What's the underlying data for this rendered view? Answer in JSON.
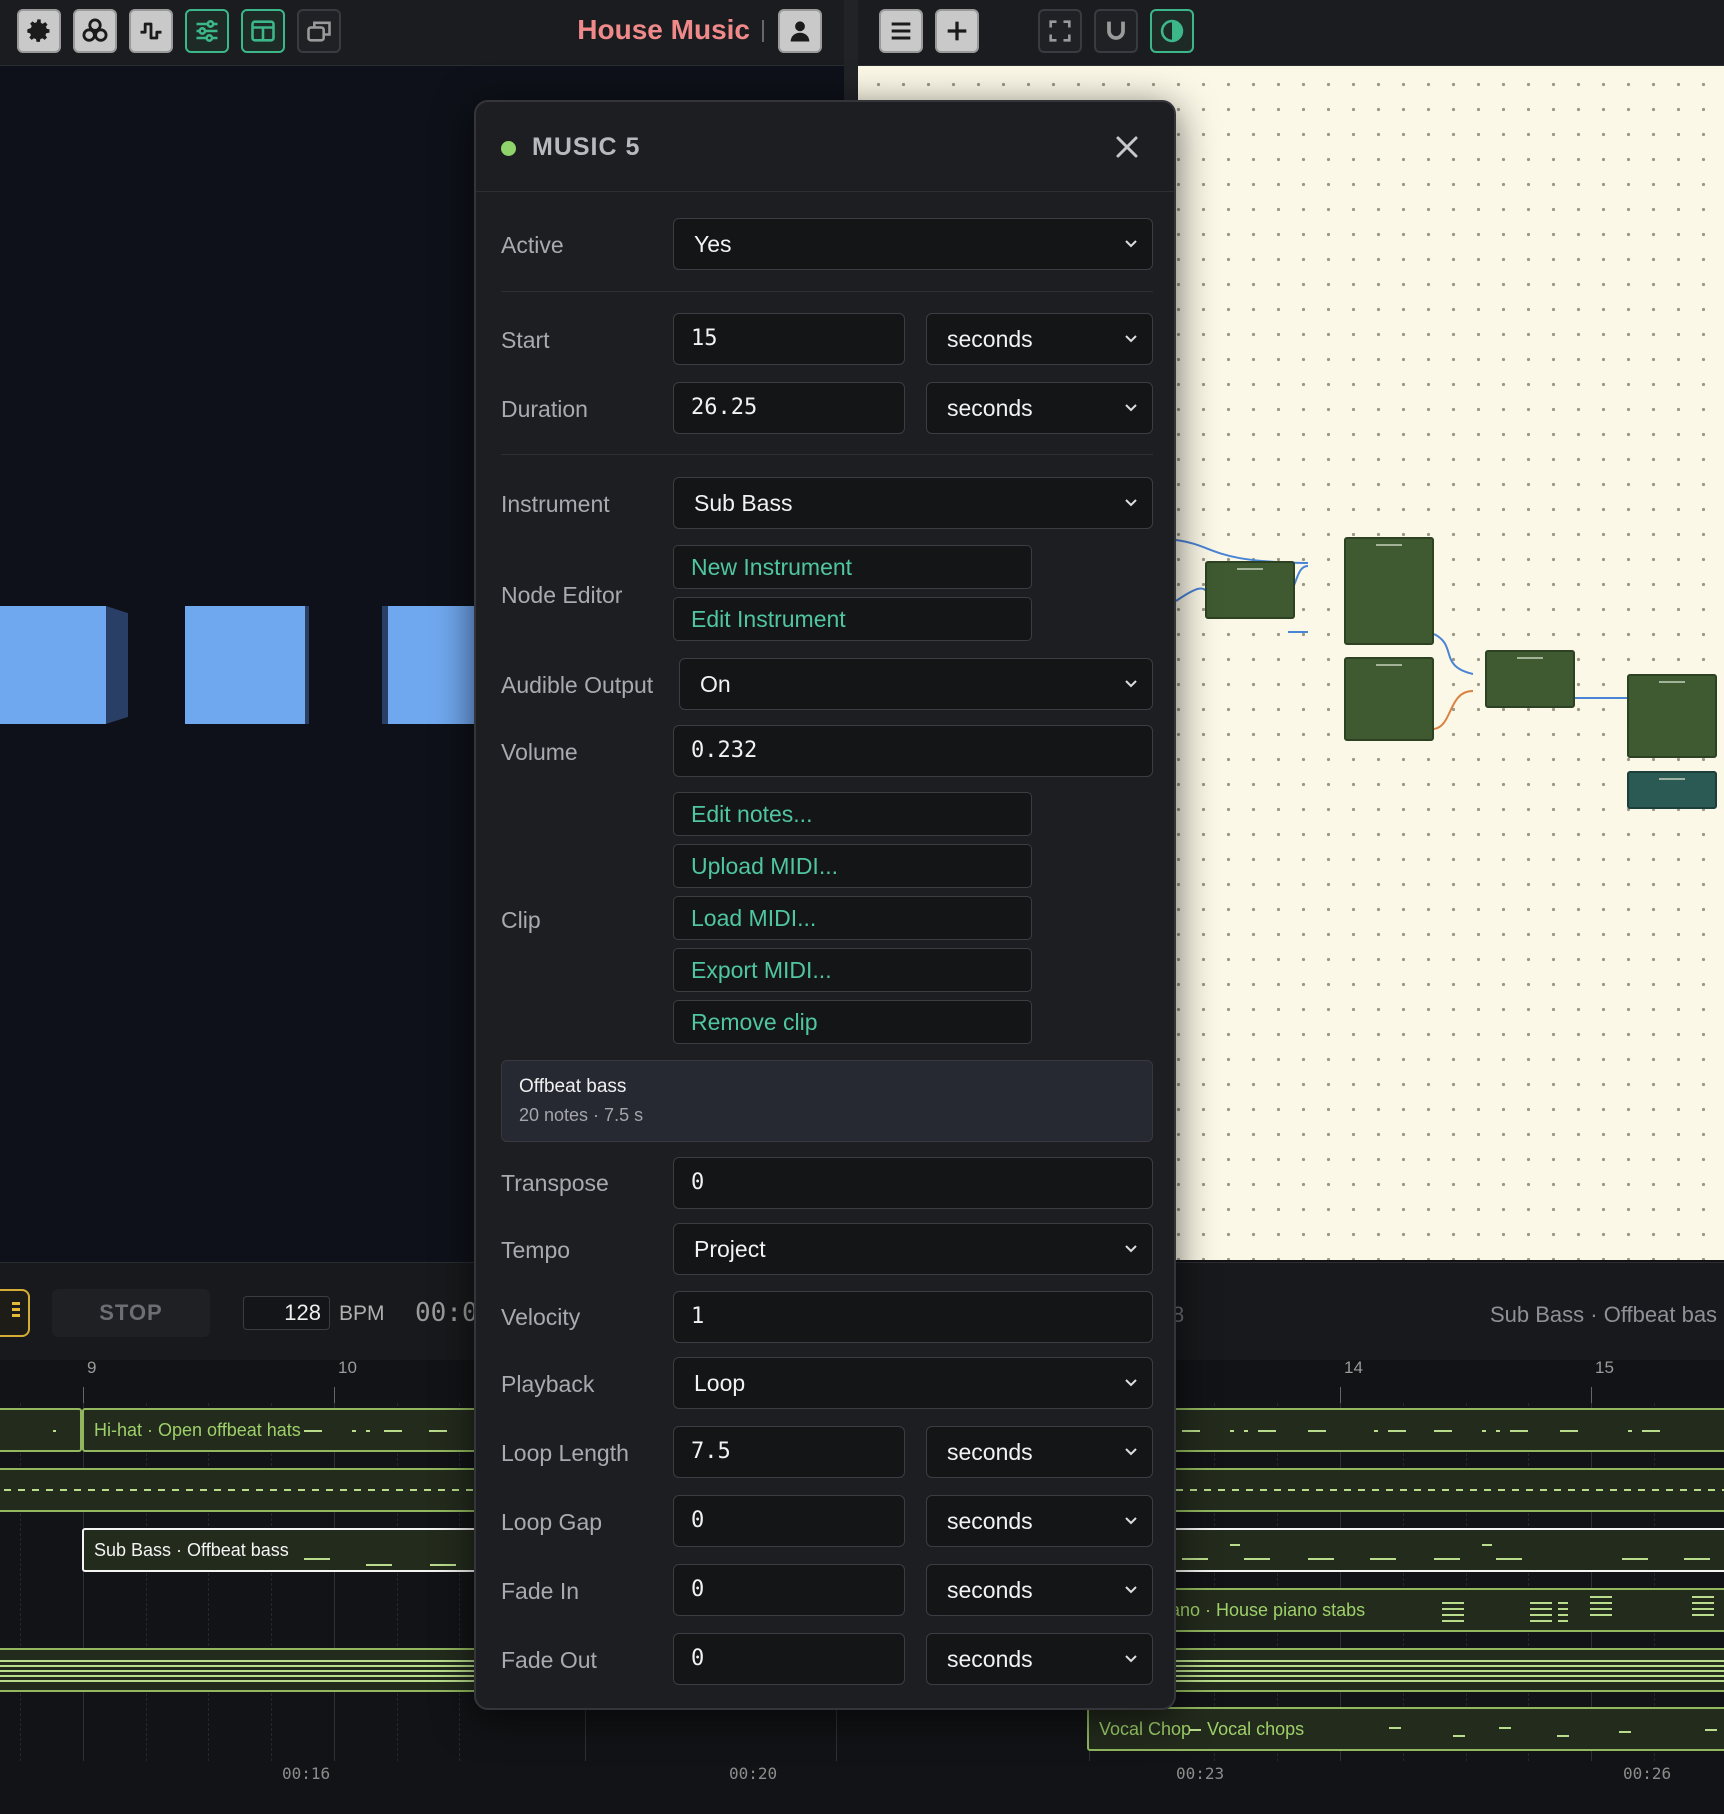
{
  "toolbar": {
    "project_title": "House Music"
  },
  "transport": {
    "stop_label": "STOP",
    "bpm_value": "128",
    "bpm_label": "BPM",
    "time_partial": "00:0",
    "marker_partial": "8",
    "selected_clip_info": "Sub Bass · Offbeat bas"
  },
  "timeline": {
    "ruler": [
      "9",
      "10",
      "14",
      "15"
    ],
    "times": [
      "00:16",
      "00:20",
      "00:23",
      "00:26"
    ],
    "tracks": {
      "hihat": "Hi-hat · Open offbeat hats",
      "subbass": "Sub Bass · Offbeat bass",
      "piano": "ano · House piano stabs",
      "vocal": "Vocal Chop · Vocal chops"
    }
  },
  "dialog": {
    "title": "MUSIC 5",
    "status_color": "#8fd36b",
    "fields": {
      "active": {
        "label": "Active",
        "value": "Yes"
      },
      "start": {
        "label": "Start",
        "value": "15",
        "unit": "seconds"
      },
      "duration": {
        "label": "Duration",
        "value": "26.25",
        "unit": "seconds"
      },
      "instrument": {
        "label": "Instrument",
        "value": "Sub Bass"
      },
      "node_editor": {
        "label": "Node Editor",
        "new_button": "New Instrument",
        "edit_button": "Edit Instrument"
      },
      "audible_output": {
        "label": "Audible Output",
        "value": "On"
      },
      "volume": {
        "label": "Volume",
        "value": "0.232"
      },
      "clip": {
        "label": "Clip",
        "buttons": [
          "Edit notes...",
          "Upload MIDI...",
          "Load MIDI...",
          "Export MIDI...",
          "Remove clip"
        ],
        "name": "Offbeat bass",
        "meta": "20 notes · 7.5 s"
      },
      "transpose": {
        "label": "Transpose",
        "value": "0"
      },
      "tempo": {
        "label": "Tempo",
        "value": "Project"
      },
      "velocity": {
        "label": "Velocity",
        "value": "1"
      },
      "playback": {
        "label": "Playback",
        "value": "Loop"
      },
      "loop_length": {
        "label": "Loop Length",
        "value": "7.5",
        "unit": "seconds"
      },
      "loop_gap": {
        "label": "Loop Gap",
        "value": "0",
        "unit": "seconds"
      },
      "fade_in": {
        "label": "Fade In",
        "value": "0",
        "unit": "seconds"
      },
      "fade_out": {
        "label": "Fade Out",
        "value": "0",
        "unit": "seconds"
      }
    }
  },
  "icons": {
    "toolbar": [
      "gear-icon",
      "biohazard-icon",
      "waveform-icon",
      "sliders-icon",
      "layout-icon",
      "windows-icon",
      "user-icon",
      "menu-icon",
      "plus-icon",
      "fullscreen-icon",
      "magnet-icon",
      "contrast-icon"
    ]
  },
  "colors": {
    "accent": "#4fc6a0",
    "title": "#f08a8a",
    "track_border": "#92b75f",
    "play_border": "#d5ad35"
  }
}
